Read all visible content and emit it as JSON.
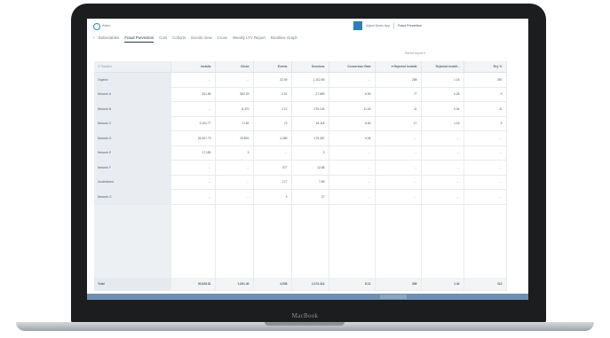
{
  "device": {
    "brand": "MacBook"
  },
  "app": {
    "name": "Abbo"
  },
  "user": {
    "name": "Adjust Demo App",
    "company": "Fraud Prevention"
  },
  "nav": {
    "back_icon": "chevron-left-icon",
    "tabs": [
      {
        "label": "Deliverables",
        "active": false
      },
      {
        "label": "Fraud Prevention",
        "active": true
      },
      {
        "label": "Cost",
        "active": false
      },
      {
        "label": "Cohorts",
        "active": false
      },
      {
        "label": "Events View",
        "active": false
      },
      {
        "label": "Cross",
        "active": false
      },
      {
        "label": "Weekly LTV Report",
        "active": false
      },
      {
        "label": "Realtime Graph",
        "active": false
      }
    ]
  },
  "saved_view": {
    "label": "Saved report"
  },
  "table": {
    "search_placeholder": "Trackers",
    "columns": [
      "Installs",
      "Clicks",
      "Events",
      "Sessions",
      "Conversion Rate",
      "Rejected Installs",
      "Rejected Install...",
      "Rej. %"
    ],
    "rows": [
      {
        "name": "Organic",
        "cells": [
          "—",
          "—",
          "22.09",
          "1,102.89",
          "—",
          "288",
          "1.18",
          "287"
        ]
      },
      {
        "name": "Network A",
        "cells": [
          "261.89",
          "962.29",
          "2.01",
          "27.889",
          "6.83",
          "77",
          "0.28",
          "9"
        ]
      },
      {
        "name": "Network B",
        "cells": [
          "—",
          "8.370",
          "1.12",
          "175.126",
          "11.03",
          "11",
          "0.04",
          "11"
        ]
      },
      {
        "name": "Network C",
        "cells": [
          "3,101.77",
          "71.81",
          "73",
          "18.118",
          "6.83",
          "17",
          "1.15",
          "5"
        ]
      },
      {
        "name": "Network D",
        "cells": [
          "26,497.73",
          "29.891",
          "4,289",
          "179.487",
          "9.28",
          "—",
          "—",
          "—"
        ]
      },
      {
        "name": "Network E",
        "cells": [
          "17,189",
          "3",
          "—",
          "3",
          "—",
          "—",
          "—",
          "—"
        ]
      },
      {
        "name": "Network F",
        "cells": [
          "—",
          "—",
          "377",
          "12.88",
          "—",
          "—",
          "—",
          "—"
        ]
      },
      {
        "name": "Unattributed",
        "cells": [
          "—",
          "—",
          "177",
          "7.89",
          "—",
          "—",
          "—",
          "—"
        ]
      },
      {
        "name": "Network G",
        "cells": [
          "—",
          "—",
          "3",
          "27",
          "—",
          "—",
          "—",
          "—"
        ]
      }
    ],
    "total": {
      "name": "Total",
      "cells": [
        "30,628.81",
        "1,061.40",
        "4,938",
        "2,174.414",
        "8.12",
        "389",
        "1.44",
        "312"
      ]
    }
  },
  "colors": {
    "accent": "#1b8fd0",
    "statusbar": "#6d8fb3"
  }
}
